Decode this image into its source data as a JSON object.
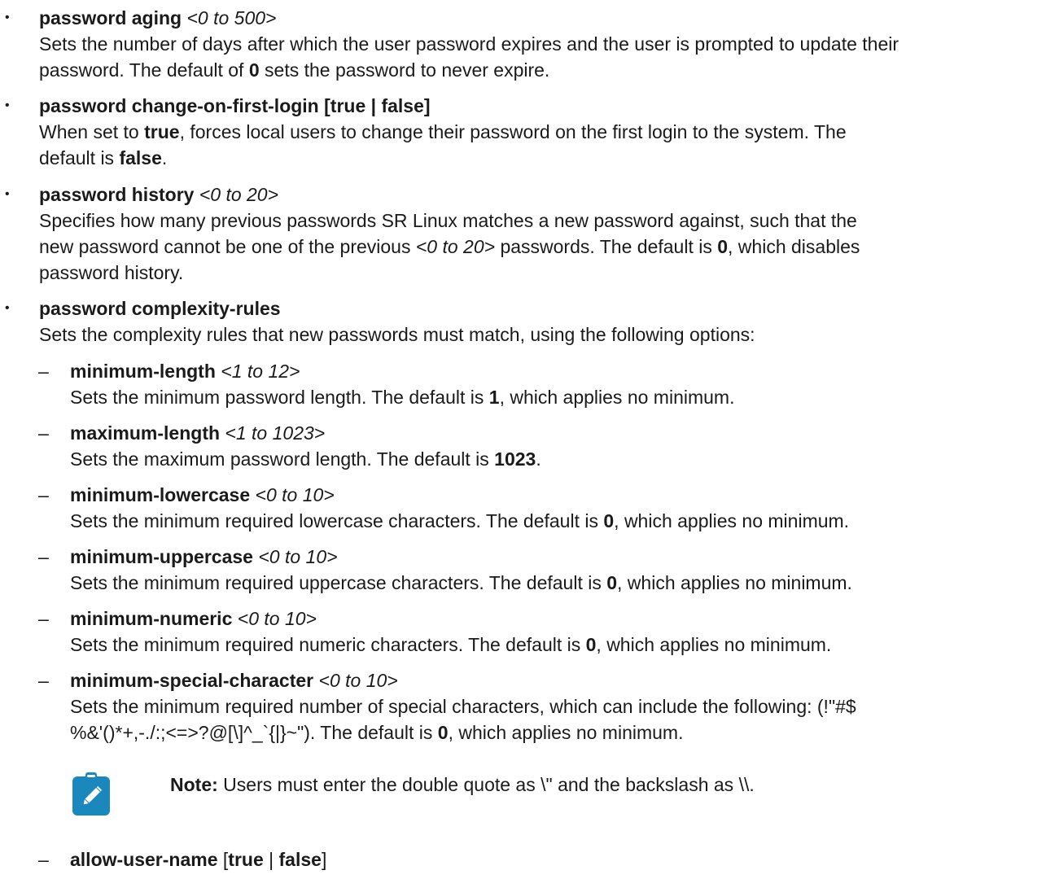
{
  "items": [
    {
      "bullet": "•",
      "cmd": "password aging",
      "range": "<0 to 500>",
      "desc1": "Sets the number of days after which the user password expires and the user is prompted to update their",
      "desc2_a": "password. The default of ",
      "desc2_b": "0",
      "desc2_c": " sets the password to never expire."
    },
    {
      "bullet": "•",
      "cmd": "password change-on-first-login [true | false]",
      "desc1_a": "When set to ",
      "desc1_b": "true",
      "desc1_c": ", forces local users to change their password on the first login to the system. The",
      "desc2_a": "default is ",
      "desc2_b": "false",
      "desc2_c": "."
    },
    {
      "bullet": "•",
      "cmd": "password history",
      "range": "<0 to 20>",
      "desc1": "Specifies how many previous passwords SR Linux matches a new password against, such that the",
      "desc2_a": "new password cannot be one of the previous ",
      "desc2_b": "<0 to 20>",
      "desc2_c": " passwords. The default is ",
      "desc2_d": "0",
      "desc2_e": ", which disables",
      "desc3": "password history."
    },
    {
      "bullet": "•",
      "cmd": "password complexity-rules",
      "desc1": "Sets the complexity rules that new passwords must match, using the following options:"
    }
  ],
  "subitems": [
    {
      "dash": "–",
      "cmd": "minimum-length",
      "range": "<1 to 12>",
      "desc_a": "Sets the minimum password length. The default is ",
      "desc_b": "1",
      "desc_c": ", which applies no minimum."
    },
    {
      "dash": "–",
      "cmd": "maximum-length",
      "range": "<1 to 1023>",
      "desc_a": "Sets the maximum password length. The default is ",
      "desc_b": "1023",
      "desc_c": "."
    },
    {
      "dash": "–",
      "cmd": "minimum-lowercase",
      "range": "<0 to 10>",
      "desc_a": "Sets the minimum required lowercase characters. The default is ",
      "desc_b": "0",
      "desc_c": ", which applies no minimum."
    },
    {
      "dash": "–",
      "cmd": "minimum-uppercase",
      "range": "<0 to 10>",
      "desc_a": "Sets the minimum required uppercase characters. The default is ",
      "desc_b": "0",
      "desc_c": ", which applies no minimum."
    },
    {
      "dash": "–",
      "cmd": "minimum-numeric",
      "range": "<0 to 10>",
      "desc_a": "Sets the minimum required numeric characters. The default is ",
      "desc_b": "0",
      "desc_c": ", which applies no minimum."
    },
    {
      "dash": "–",
      "cmd": "minimum-special-character",
      "range": "<0 to 10>",
      "desc1": "Sets the minimum required number of special characters, which can include the following: (!\"#$",
      "desc2_a": "%&'()*+,-./:;<=>?@[\\]^_`{|}~\"). The default is ",
      "desc2_b": "0",
      "desc2_c": ", which applies no minimum."
    },
    {
      "dash": "–",
      "cmd": "allow-user-name",
      "opt_a": " [",
      "opt_b": "true",
      "opt_c": " | ",
      "opt_d": "false",
      "opt_e": "]"
    }
  ],
  "note": {
    "label": "Note:",
    "text_a": " Users must enter the double quote as ",
    "code1": "\\\"",
    "text_b": " and the backslash as ",
    "code2": "\\\\",
    "text_c": ".",
    "icon": "pencil-note-icon",
    "icon_color": "#1a88bd"
  }
}
